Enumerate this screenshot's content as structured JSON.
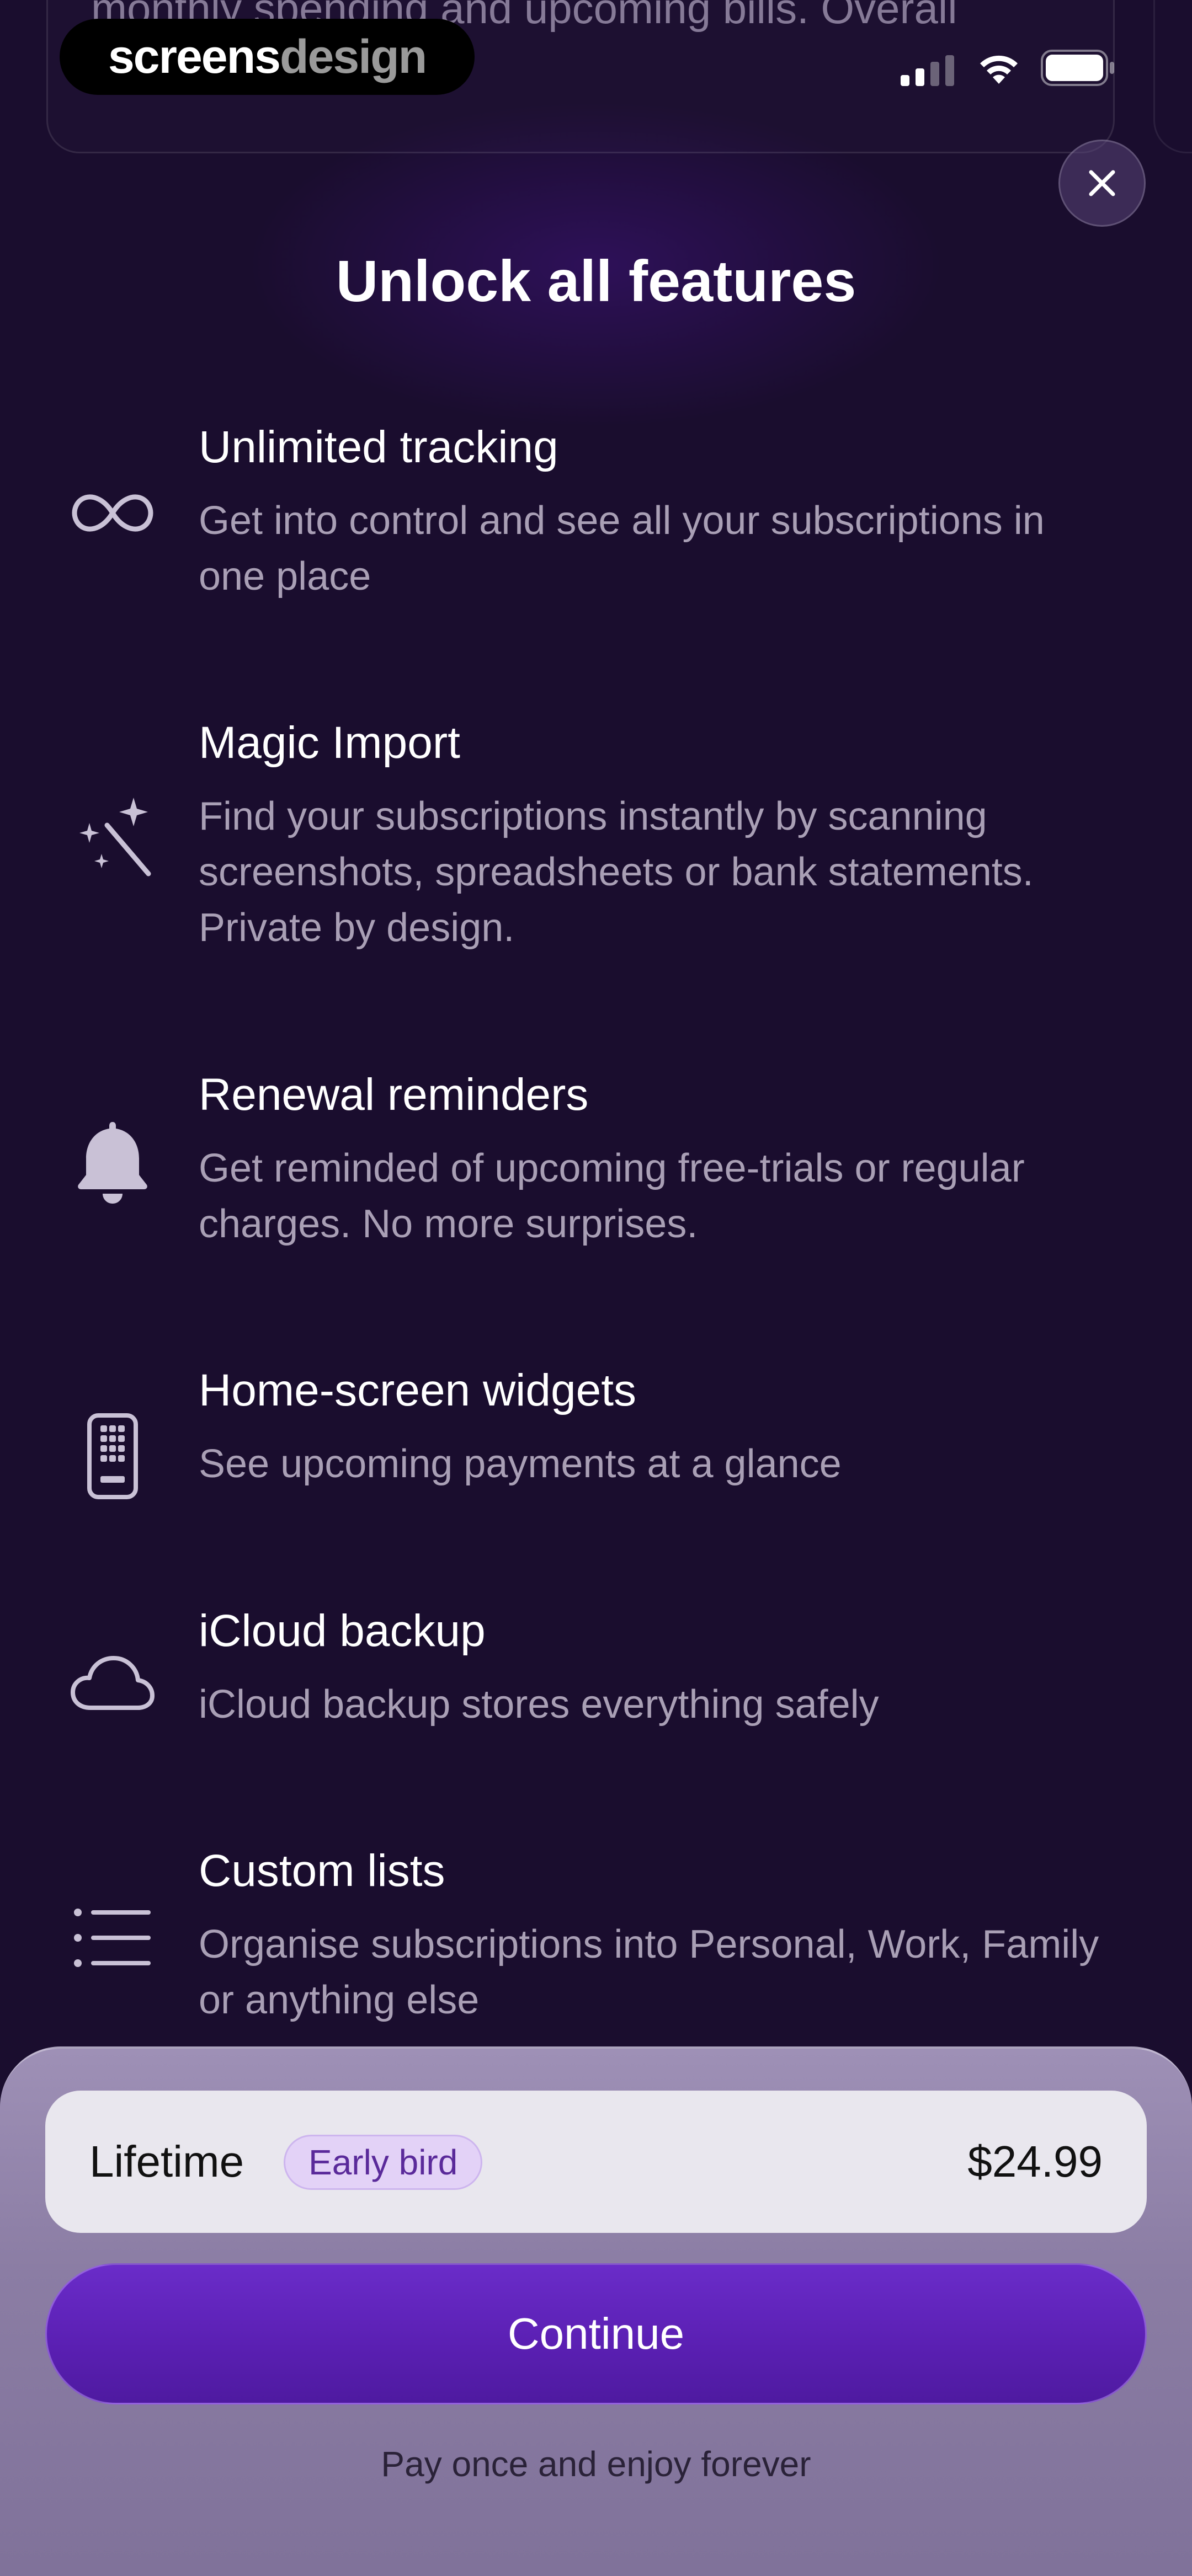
{
  "background_card": {
    "text": "monthly spending and upcoming bills. Overall"
  },
  "watermark": {
    "part1": "screens",
    "part2": "design"
  },
  "status_bar": {
    "signal_icon": "cellular-signal-icon",
    "wifi_icon": "wifi-icon",
    "battery_icon": "battery-icon"
  },
  "close_icon": "close-icon",
  "title": "Unlock all features",
  "features": [
    {
      "icon": "infinity-icon",
      "title": "Unlimited tracking",
      "desc": "Get into control and see all your subscriptions in one place"
    },
    {
      "icon": "magic-wand-icon",
      "title": "Magic Import",
      "desc": "Find your subscriptions instantly by scanning screenshots, spreadsheets or bank statements. Private by design."
    },
    {
      "icon": "bell-icon",
      "title": "Renewal reminders",
      "desc": "Get reminded of upcoming free-trials or regular charges. No more surprises."
    },
    {
      "icon": "phone-widget-icon",
      "title": "Home-screen widgets",
      "desc": "See upcoming payments at a glance"
    },
    {
      "icon": "cloud-icon",
      "title": "iCloud backup",
      "desc": "iCloud backup stores everything safely"
    },
    {
      "icon": "list-icon",
      "title": "Custom lists",
      "desc": "Organise subscriptions into Personal, Work, Family or anything else"
    }
  ],
  "plan": {
    "name": "Lifetime",
    "badge": "Early bird",
    "price": "$24.99"
  },
  "continue_label": "Continue",
  "footer_note": "Pay once and enjoy forever",
  "colors": {
    "background": "#1a0d2e",
    "accent": "#5a1fb2",
    "muted_text": "#a99fb5",
    "badge_bg": "#e3d2f7",
    "badge_text": "#5a2a9a"
  }
}
